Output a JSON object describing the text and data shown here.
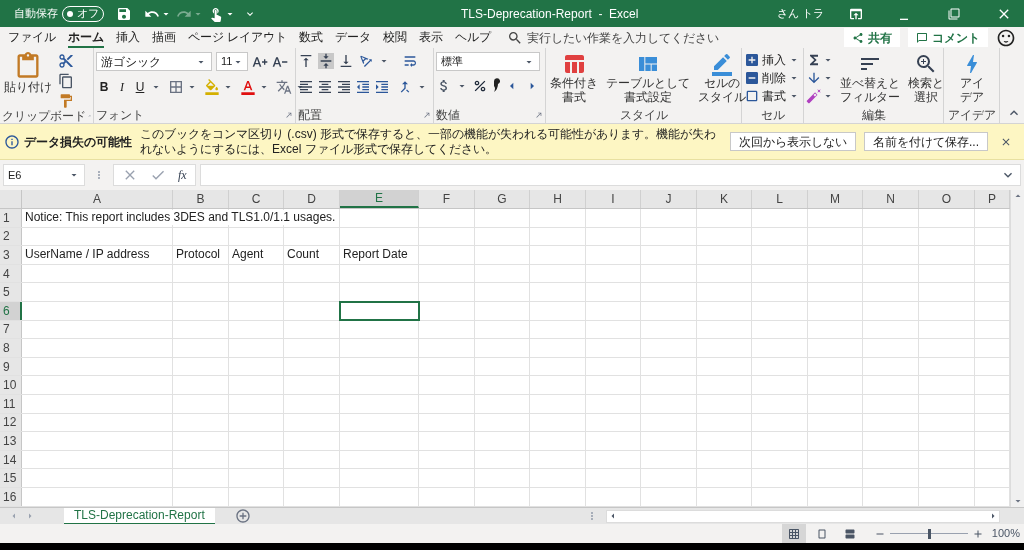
{
  "title_bar": {
    "autosave_label": "自動保存",
    "autosave_state": "オフ",
    "autosave_on": false,
    "title": "TLS-Deprecation-Report  -  Excel",
    "user": "さん トラ"
  },
  "ribbon_tabs": [
    {
      "label": "ファイル",
      "selected": false
    },
    {
      "label": "ホーム",
      "selected": true
    },
    {
      "label": "挿入",
      "selected": false
    },
    {
      "label": "描画",
      "selected": false
    },
    {
      "label": "ページ レイアウト",
      "selected": false
    },
    {
      "label": "数式",
      "selected": false
    },
    {
      "label": "データ",
      "selected": false
    },
    {
      "label": "校閲",
      "selected": false
    },
    {
      "label": "表示",
      "selected": false
    },
    {
      "label": "ヘルプ",
      "selected": false
    }
  ],
  "tell_me": "実行したい作業を入力してください",
  "share": "共有",
  "comment": "コメント",
  "ribbon": {
    "clipboard": {
      "label": "クリップボード",
      "paste": "貼り付け"
    },
    "font": {
      "label": "フォント",
      "font_name": "游ゴシック",
      "font_size": "11",
      "bold": "B",
      "italic": "I",
      "underline": "U"
    },
    "alignment": {
      "label": "配置"
    },
    "number": {
      "label": "数値",
      "format": "標準"
    },
    "styles": {
      "label": "スタイル",
      "buttons": [
        [
          "条件付き",
          "書式"
        ],
        [
          "テーブルとして",
          "書式設定"
        ],
        [
          "セルの",
          "スタイル"
        ]
      ]
    },
    "cells": {
      "label": "セル",
      "buttons": [
        "挿入",
        "削除",
        "書式"
      ]
    },
    "editing": {
      "label": "編集",
      "buttons": [
        [
          "並べ替えと",
          "フィルター"
        ],
        [
          "検索と",
          "選択"
        ]
      ]
    },
    "ideas": {
      "label": "アイデア",
      "button": [
        "アイ",
        "デア"
      ]
    }
  },
  "info_bar": {
    "title": "データ損失の可能性",
    "message": "このブックをコンマ区切り (.csv) 形式で保存すると、一部の機能が失われる可能性があります。機能が失われないようにするには、Excel ファイル形式で保存してください。",
    "buttons": [
      "次回から表示しない",
      "名前を付けて保存..."
    ]
  },
  "formula_bar": {
    "name_box": "E6",
    "fx": "fx"
  },
  "columns": [
    {
      "label": "A",
      "selected": false
    },
    {
      "label": "B",
      "selected": false
    },
    {
      "label": "C",
      "selected": false
    },
    {
      "label": "D",
      "selected": false
    },
    {
      "label": "E",
      "selected": true
    },
    {
      "label": "F",
      "selected": false
    },
    {
      "label": "G",
      "selected": false
    },
    {
      "label": "H",
      "selected": false
    },
    {
      "label": "I",
      "selected": false
    },
    {
      "label": "J",
      "selected": false
    },
    {
      "label": "K",
      "selected": false
    },
    {
      "label": "L",
      "selected": false
    },
    {
      "label": "M",
      "selected": false
    },
    {
      "label": "N",
      "selected": false
    },
    {
      "label": "O",
      "selected": false
    },
    {
      "label": "P",
      "selected": false
    }
  ],
  "rows": [
    {
      "number": "1",
      "selected": false,
      "cells": [
        "Notice: This report includes 3DES and TLS1.0/1.1 usages."
      ]
    },
    {
      "number": "2",
      "selected": false
    },
    {
      "number": "3",
      "selected": false,
      "cells": [
        "UserName / IP address",
        "Protocol",
        "Agent",
        "Count",
        "Report Date"
      ]
    },
    {
      "number": "4",
      "selected": false
    },
    {
      "number": "5",
      "selected": false
    },
    {
      "number": "6",
      "selected": true
    },
    {
      "number": "7",
      "selected": false
    },
    {
      "number": "8",
      "selected": false
    },
    {
      "number": "9",
      "selected": false
    },
    {
      "number": "10",
      "selected": false
    },
    {
      "number": "11",
      "selected": false
    },
    {
      "number": "12",
      "selected": false
    },
    {
      "number": "13",
      "selected": false
    },
    {
      "number": "14",
      "selected": false
    },
    {
      "number": "15",
      "selected": false
    },
    {
      "number": "16",
      "selected": false
    }
  ],
  "sheet_tabs": [
    {
      "label": "TLS-Deprecation-Report",
      "selected": true
    }
  ],
  "status_bar": {
    "views": [
      {
        "kind": "normal",
        "selected": true
      },
      {
        "kind": "page_layout",
        "selected": false
      },
      {
        "kind": "page_break",
        "selected": false
      }
    ],
    "zoom": {
      "level": 0.5,
      "reading": "100%"
    }
  }
}
